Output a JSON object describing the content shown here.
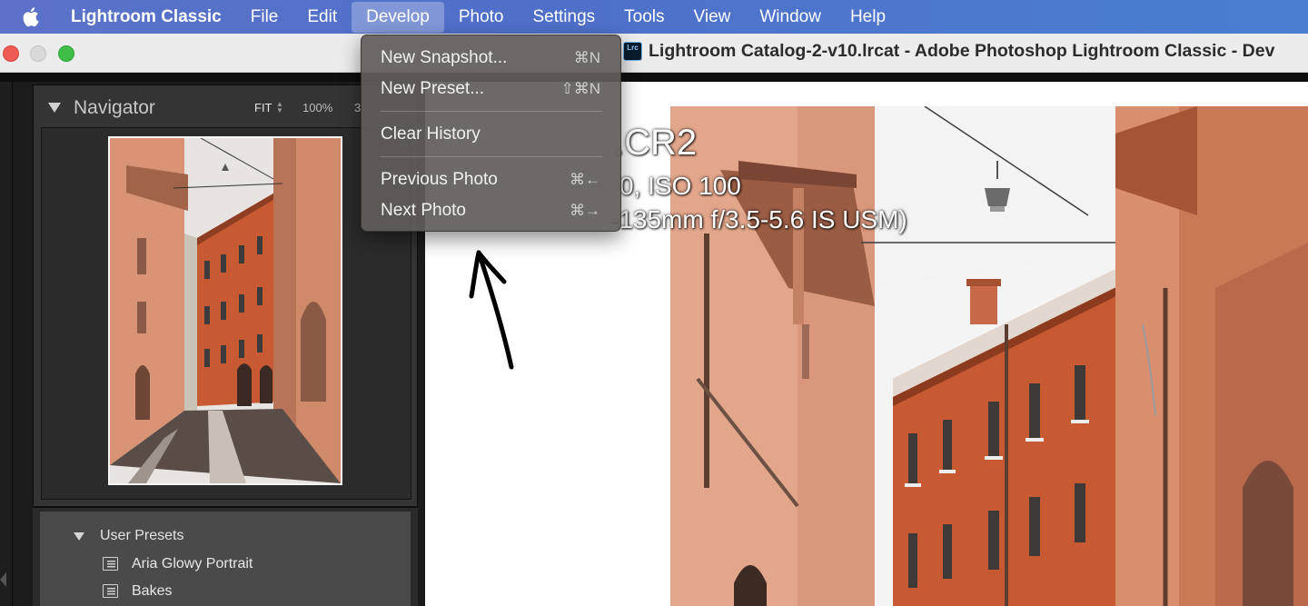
{
  "menubar": {
    "apple_icon": "apple-logo-icon",
    "app_name": "Lightroom Classic",
    "items": [
      "File",
      "Edit",
      "Develop",
      "Photo",
      "Settings",
      "Tools",
      "View",
      "Window",
      "Help"
    ],
    "active": "Develop"
  },
  "window": {
    "app_icon_text": "Lrc",
    "title": "Lightroom Catalog-2-v10.lrcat - Adobe Photoshop Lightroom Classic - Dev"
  },
  "develop_menu": {
    "items": [
      {
        "label": "New Snapshot...",
        "shortcut": "⌘N"
      },
      {
        "label": "New Preset...",
        "shortcut": "⇧⌘N"
      },
      {
        "label": "Clear History",
        "shortcut": ""
      },
      {
        "label": "Previous Photo",
        "shortcut": "⌘←"
      },
      {
        "label": "Next Photo",
        "shortcut": "⌘→"
      }
    ]
  },
  "navigator": {
    "title": "Navigator",
    "zoom_fit": "FIT",
    "zoom_100": "100%",
    "zoom_more": "3"
  },
  "presets": {
    "group": "User Presets",
    "items": [
      "Aria Glowy Portrait",
      "Bakes"
    ]
  },
  "photo_info": {
    "line1": ".CR2",
    "line2": "0, ISO 100",
    "line3": "-135mm f/3.5-5.6 IS USM)"
  },
  "colors": {
    "menubar": "#5072c8",
    "dropdown_bg": "#605c5a",
    "panel_bg": "#343434",
    "building_orange": "#c95c34",
    "building_pink": "#d9967a"
  }
}
